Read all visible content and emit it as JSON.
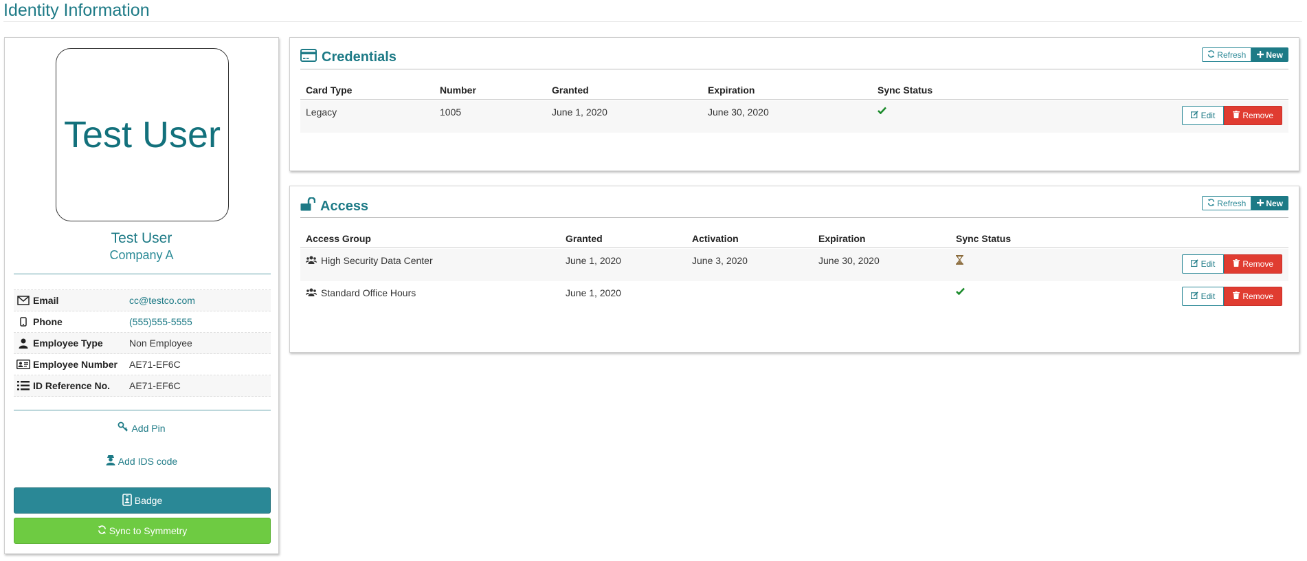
{
  "page": {
    "title": "Identity Information"
  },
  "profile": {
    "avatar_text": "Test User",
    "name": "Test User",
    "company": "Company A",
    "fields": [
      {
        "icon": "envelope-icon",
        "label": "Email",
        "value": "cc@testco.com"
      },
      {
        "icon": "phone-icon",
        "label": "Phone",
        "value": "(555)555-5555"
      },
      {
        "icon": "user-icon",
        "label": "Employee Type",
        "value": "Non Employee"
      },
      {
        "icon": "id-card-icon",
        "label": "Employee Number",
        "value": "AE71-EF6C"
      },
      {
        "icon": "list-icon",
        "label": "ID Reference No.",
        "value": "AE71-EF6C"
      }
    ],
    "add_pin_label": "Add Pin",
    "add_ids_label": "Add IDS code",
    "badge_label": "Badge",
    "sync_label": "Sync to Symmetry"
  },
  "credentials": {
    "title": "Credentials",
    "refresh_label": "Refresh",
    "new_label": "New",
    "columns": [
      "Card Type",
      "Number",
      "Granted",
      "Expiration",
      "Sync Status"
    ],
    "rows": [
      {
        "card_type": "Legacy",
        "number": "1005",
        "granted": "June 1, 2020",
        "expiration": "June 30, 2020",
        "sync_status": "synced",
        "sync_icon": "check-icon"
      }
    ],
    "edit_label": "Edit",
    "remove_label": "Remove"
  },
  "access": {
    "title": "Access",
    "refresh_label": "Refresh",
    "new_label": "New",
    "columns": [
      "Access Group",
      "Granted",
      "Activation",
      "Expiration",
      "Sync Status"
    ],
    "rows": [
      {
        "group": "High Security Data Center",
        "granted": "June 1, 2020",
        "activation": "June 3, 2020",
        "expiration": "June 30, 2020",
        "sync_status": "pending",
        "sync_icon": "hourglass-icon"
      },
      {
        "group": "Standard Office Hours",
        "granted": "June 1, 2020",
        "activation": "",
        "expiration": "",
        "sync_status": "synced",
        "sync_icon": "check-icon"
      }
    ],
    "edit_label": "Edit",
    "remove_label": "Remove"
  },
  "colors": {
    "accent": "#1d7a86",
    "badge_button": "#2a8896",
    "sync_button": "#6ecb42",
    "remove_button": "#e03c31",
    "check": "#1a8a2a"
  }
}
